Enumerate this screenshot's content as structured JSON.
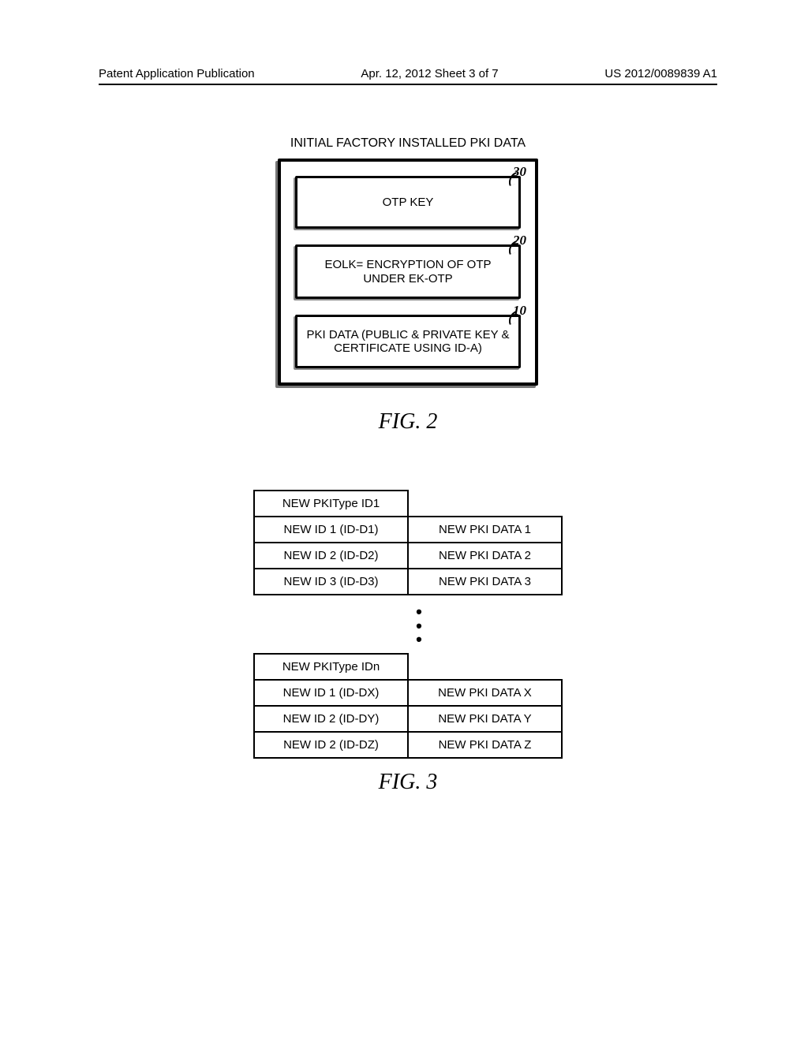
{
  "header": {
    "left": "Patent Application Publication",
    "center": "Apr. 12, 2012  Sheet 3 of 7",
    "right": "US 2012/0089839 A1"
  },
  "fig2": {
    "title": "INITIAL FACTORY INSTALLED PKI DATA",
    "boxes": [
      {
        "ref": "30",
        "text": "OTP KEY"
      },
      {
        "ref": "20",
        "text": "EOLK= ENCRYPTION OF OTP UNDER EK-OTP"
      },
      {
        "ref": "10",
        "text": "PKI DATA (PUBLIC & PRIVATE KEY & CERTIFICATE USING ID-A)"
      }
    ],
    "caption": "FIG. 2"
  },
  "fig3": {
    "table1": {
      "header": "NEW PKIType ID1",
      "rows": [
        {
          "left": "NEW ID 1 (ID-D1)",
          "right": "NEW PKI DATA 1"
        },
        {
          "left": "NEW ID 2 (ID-D2)",
          "right": "NEW PKI DATA 2"
        },
        {
          "left": "NEW ID 3 (ID-D3)",
          "right": "NEW PKI DATA 3"
        }
      ]
    },
    "table2": {
      "header": "NEW PKIType IDn",
      "rows": [
        {
          "left": "NEW ID 1 (ID-DX)",
          "right": "NEW PKI DATA X"
        },
        {
          "left": "NEW ID 2 (ID-DY)",
          "right": "NEW PKI DATA Y"
        },
        {
          "left": "NEW ID 2 (ID-DZ)",
          "right": "NEW PKI DATA Z"
        }
      ]
    },
    "caption": "FIG. 3"
  }
}
